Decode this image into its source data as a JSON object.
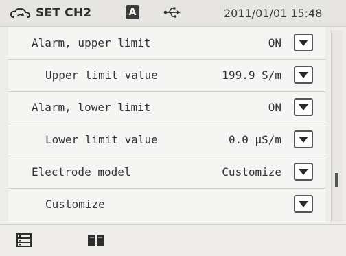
{
  "header": {
    "title": "SET CH2",
    "mode_badge": "A",
    "datetime": "2011/01/01 15:48",
    "icons": [
      "cloud-sync-icon",
      "usb-icon"
    ]
  },
  "rows": [
    {
      "label": "Alarm, upper limit",
      "value": "ON"
    },
    {
      "label": "Upper limit value",
      "value": "199.9 S/m"
    },
    {
      "label": "Alarm, lower limit",
      "value": "ON"
    },
    {
      "label": "Lower limit value",
      "value": "0.0 μS/m"
    },
    {
      "label": "Electrode model",
      "value": "Customize"
    },
    {
      "label": "Customize",
      "value": ""
    }
  ],
  "scrollbar": {
    "position_fraction": 0.8
  },
  "footer": {
    "icons": [
      "list-icon",
      "book-icon"
    ]
  }
}
